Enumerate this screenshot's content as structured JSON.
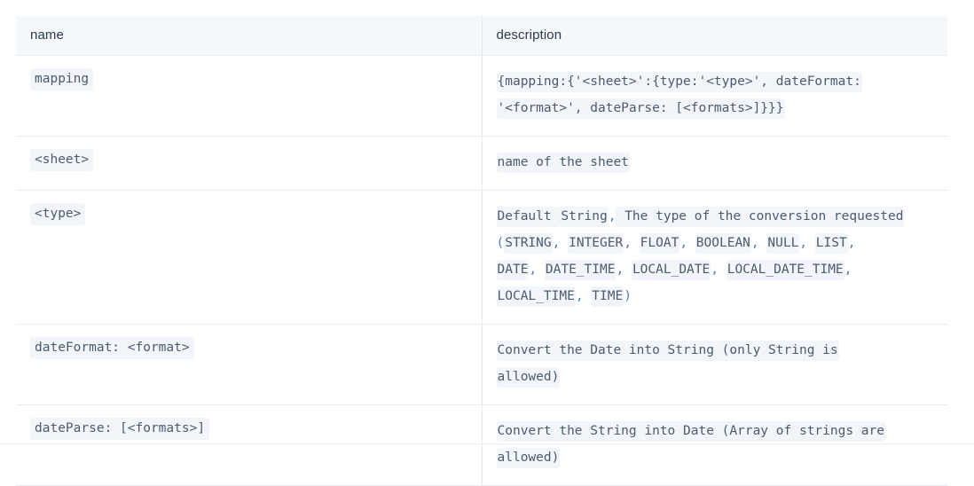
{
  "table": {
    "columns": [
      {
        "key": "name",
        "label": "name"
      },
      {
        "key": "description",
        "label": "description"
      }
    ],
    "rows": [
      {
        "name": "mapping",
        "description_lines": [
          [
            {
              "text": "{mapping:{'<sheet>':{type:'<type>', dateFormat:",
              "style": "code"
            }
          ],
          [
            {
              "text": "'<format>', dateParse: [<formats>]}}}",
              "style": "code"
            }
          ]
        ]
      },
      {
        "name": "<sheet>",
        "description_lines": [
          [
            {
              "text": "name of the sheet",
              "style": "code"
            }
          ]
        ]
      },
      {
        "name": "<type>",
        "description_lines": [
          [
            {
              "text": "Default ",
              "style": "code"
            },
            {
              "text": "String",
              "style": "code"
            },
            {
              "text": ",",
              "style": "punc"
            },
            {
              "text": " The type of the conversion requested",
              "style": "code"
            }
          ],
          [
            {
              "text": "(",
              "style": "punc"
            },
            {
              "text": "STRING",
              "style": "code"
            },
            {
              "text": ",",
              "style": "punc"
            },
            {
              "text": " ",
              "style": "gap"
            },
            {
              "text": "INTEGER",
              "style": "code"
            },
            {
              "text": ",",
              "style": "punc"
            },
            {
              "text": " ",
              "style": "gap"
            },
            {
              "text": "FLOAT",
              "style": "code"
            },
            {
              "text": ",",
              "style": "punc"
            },
            {
              "text": " ",
              "style": "gap"
            },
            {
              "text": "BOOLEAN",
              "style": "code"
            },
            {
              "text": ",",
              "style": "punc"
            },
            {
              "text": " ",
              "style": "gap"
            },
            {
              "text": "NULL",
              "style": "code"
            },
            {
              "text": ",",
              "style": "punc"
            },
            {
              "text": " ",
              "style": "gap"
            },
            {
              "text": "LIST",
              "style": "code"
            },
            {
              "text": ",",
              "style": "punc"
            }
          ],
          [
            {
              "text": "DATE",
              "style": "code"
            },
            {
              "text": ",",
              "style": "punc"
            },
            {
              "text": " ",
              "style": "gap"
            },
            {
              "text": "DATE_TIME",
              "style": "code"
            },
            {
              "text": ",",
              "style": "punc"
            },
            {
              "text": " ",
              "style": "gap"
            },
            {
              "text": "LOCAL_DATE",
              "style": "code"
            },
            {
              "text": ",",
              "style": "punc"
            },
            {
              "text": " ",
              "style": "gap"
            },
            {
              "text": "LOCAL_DATE_TIME",
              "style": "code"
            },
            {
              "text": ",",
              "style": "punc"
            }
          ],
          [
            {
              "text": "LOCAL_TIME",
              "style": "code"
            },
            {
              "text": ",",
              "style": "punc"
            },
            {
              "text": " ",
              "style": "gap"
            },
            {
              "text": "TIME",
              "style": "code"
            },
            {
              "text": ")",
              "style": "punc"
            }
          ]
        ]
      },
      {
        "name": "dateFormat: <format>",
        "description_lines": [
          [
            {
              "text": "Convert the Date into String (only String is",
              "style": "code"
            }
          ],
          [
            {
              "text": "allowed)",
              "style": "code"
            }
          ]
        ]
      },
      {
        "name": "dateParse: [<formats>]",
        "description_lines": [
          [
            {
              "text": "Convert the String into Date (Array of strings are",
              "style": "code"
            }
          ],
          [
            {
              "text": "allowed)",
              "style": "code"
            }
          ]
        ]
      }
    ]
  },
  "colors": {
    "header_bg": "#f5f8fb",
    "code_bg": "#f2f6fa",
    "code_text": "#4b5b6e",
    "header_text": "#2b3a4d",
    "border": "#e7edf4",
    "punctuation_blue": "#4a7fc1"
  }
}
